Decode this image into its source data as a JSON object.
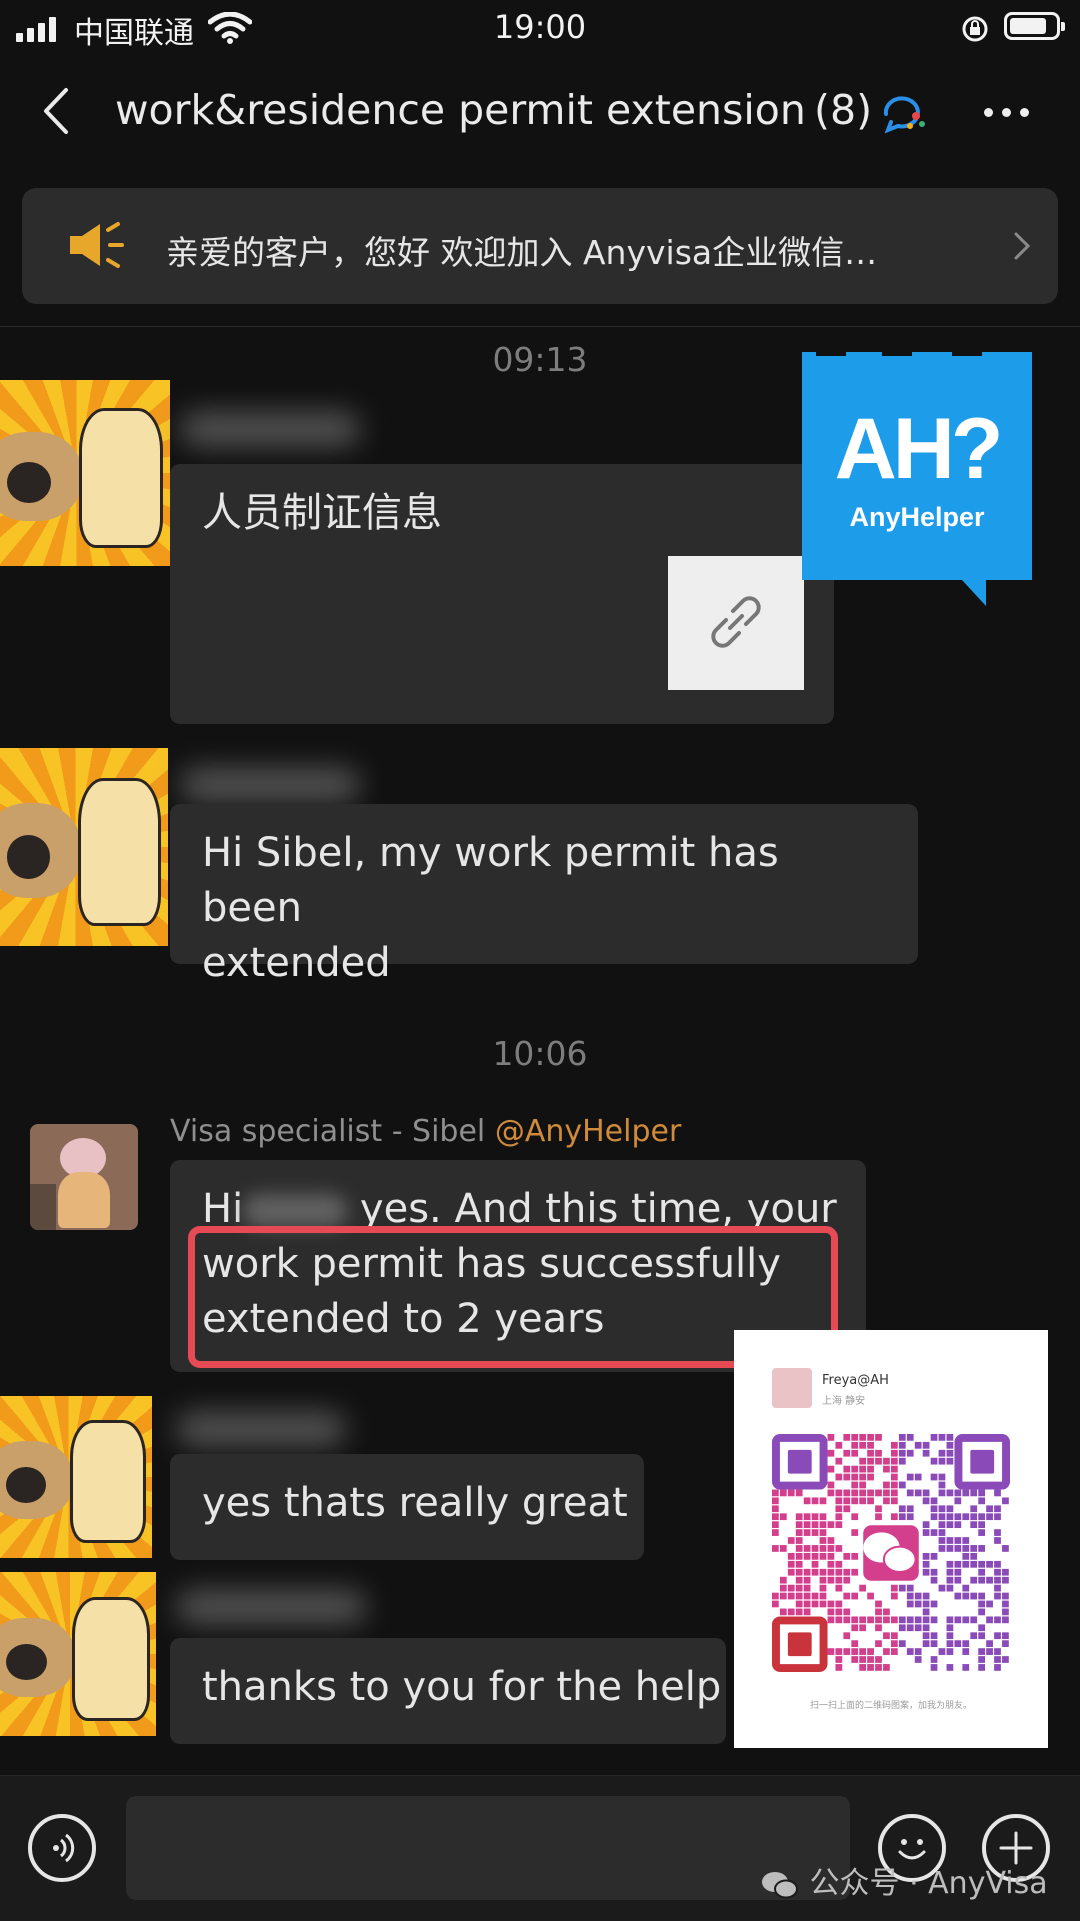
{
  "status_bar": {
    "carrier": "中国联通",
    "time": "19:00"
  },
  "header": {
    "title": "work&residence permit extension",
    "member_count": "(8)"
  },
  "notice": {
    "text": "亲爱的客户，您好 欢迎加入 Anyvisa企业微信…"
  },
  "messages": [
    {
      "time": "09:13"
    },
    {
      "link_title": "人员制证信息"
    },
    {
      "text_line1": "Hi Sibel, my work permit has been",
      "text_line2": "extended"
    },
    {
      "time": "10:06"
    },
    {
      "sender": "Visa specialist - Sibel",
      "sender_tag": "@AnyHelper",
      "line1_start": "Hi",
      "line1_end": "yes. And this time, your",
      "line2": "work permit has successfully",
      "line3": "extended to 2 years"
    },
    {
      "text": "yes thats really great"
    },
    {
      "text": "thanks to you for the help"
    }
  ],
  "ah_badge": {
    "mark": "AH?",
    "name": "AnyHelper"
  },
  "qr_card": {
    "name": "Freya@AH",
    "location": "上海 静安",
    "caption": "扫一扫上面的二维码图案，加我为朋友。",
    "colors": {
      "pink": "#d43f8d",
      "purple": "#8a4bb8",
      "red": "#c9333c"
    }
  },
  "watermark": "公众号 · AnyVisa",
  "colors": {
    "background": "#111111",
    "bubble": "#2c2c2c",
    "highlight": "#e54a55",
    "badge": "#1d9cea",
    "tag": "#d08a3c"
  },
  "icons": [
    "back-icon",
    "chat-bubble-icon",
    "more-icon",
    "speaker-icon",
    "chevron-right-icon",
    "link-icon",
    "voice-icon",
    "emoji-icon",
    "plus-icon"
  ]
}
